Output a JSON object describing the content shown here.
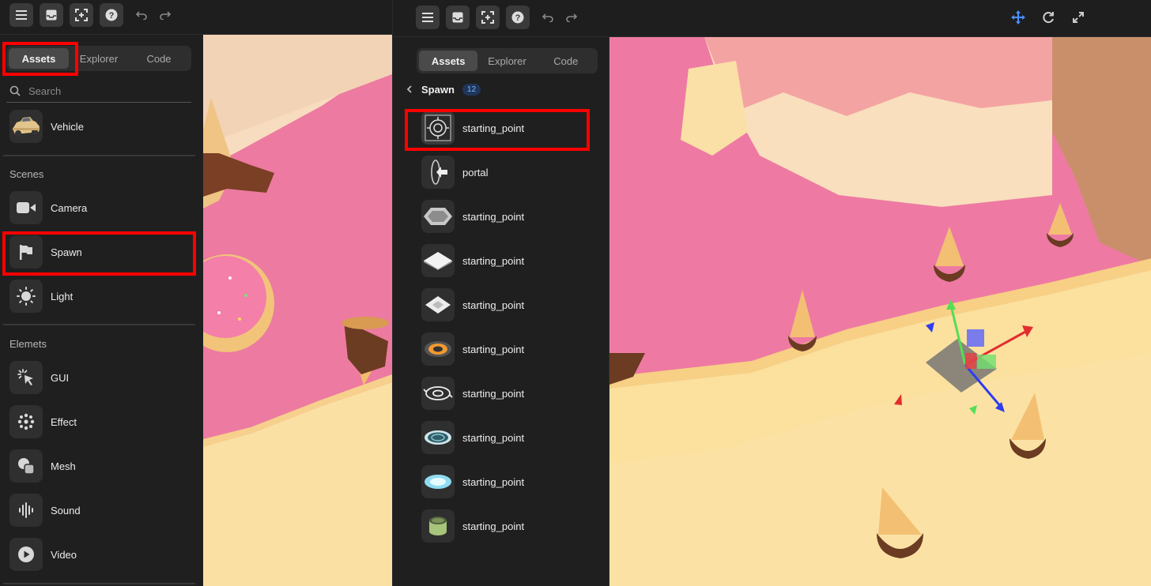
{
  "colors": {
    "highlight": "#ff0000",
    "accent_blue": "#4a90ff",
    "panel": "#1f1f1f"
  },
  "left_screen": {
    "toolbar": {
      "icons": [
        "menu-icon",
        "inbox-icon",
        "frame-add-icon",
        "help-icon",
        "undo-icon",
        "redo-icon"
      ]
    },
    "tabs": [
      "Assets",
      "Explorer",
      "Code"
    ],
    "active_tab": "Assets",
    "search": {
      "placeholder": "Search",
      "value": ""
    },
    "vehicle_item": {
      "label": "Vehicle",
      "icon": "car-icon"
    },
    "sections": {
      "scenes": {
        "title": "Scenes",
        "items": [
          {
            "label": "Camera",
            "icon": "camera-icon"
          },
          {
            "label": "Spawn",
            "icon": "flag-icon"
          },
          {
            "label": "Light",
            "icon": "sun-icon"
          }
        ]
      },
      "elements": {
        "title": "Elemets",
        "items": [
          {
            "label": "GUI",
            "icon": "cursor-click-icon"
          },
          {
            "label": "Effect",
            "icon": "sparkle-dots-icon"
          },
          {
            "label": "Mesh",
            "icon": "shapes-icon"
          },
          {
            "label": "Sound",
            "icon": "waveform-icon"
          },
          {
            "label": "Video",
            "icon": "play-icon"
          }
        ]
      }
    }
  },
  "right_screen": {
    "toolbar": {
      "icons": [
        "menu-icon",
        "inbox-icon",
        "frame-add-icon",
        "help-icon",
        "undo-icon",
        "redo-icon"
      ],
      "tools": [
        "move-tool-icon",
        "rotate-tool-icon",
        "scale-tool-icon"
      ]
    },
    "tabs": [
      "Assets",
      "Explorer",
      "Code"
    ],
    "active_tab": "Assets",
    "breadcrumb": {
      "title": "Spawn",
      "count": "12"
    },
    "items": [
      {
        "label": "starting_point",
        "icon": "target-ring-icon"
      },
      {
        "label": "portal",
        "icon": "portal-arrow-icon"
      },
      {
        "label": "starting_point",
        "icon": "hexagon-pad-icon"
      },
      {
        "label": "starting_point",
        "icon": "diamond-pad-icon"
      },
      {
        "label": "starting_point",
        "icon": "diamond-pad-icon"
      },
      {
        "label": "starting_point",
        "icon": "orange-ring-pad-icon"
      },
      {
        "label": "starting_point",
        "icon": "swirl-ring-icon"
      },
      {
        "label": "starting_point",
        "icon": "teal-ring-pad-icon"
      },
      {
        "label": "starting_point",
        "icon": "cyan-glow-pad-icon"
      },
      {
        "label": "starting_point",
        "icon": "green-cylinder-icon"
      }
    ]
  }
}
